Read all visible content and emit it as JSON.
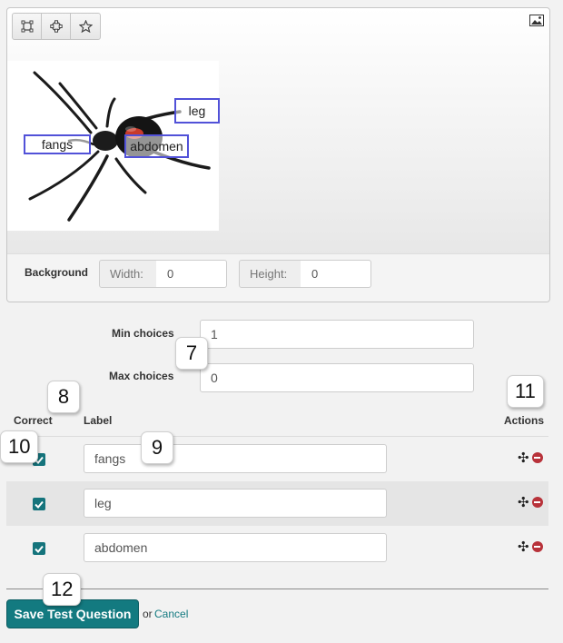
{
  "toolbar": {
    "tools": [
      "rectangle-tool-icon",
      "circle-tool-icon",
      "polygon-tool-icon"
    ],
    "image_icon": "image-icon"
  },
  "labels_on_image": {
    "leg": "leg",
    "fangs": "fangs",
    "abdomen": "abdomen"
  },
  "background": {
    "title": "Background",
    "width_label": "Width:",
    "width_value": "0",
    "height_label": "Height:",
    "height_value": "0"
  },
  "choices": {
    "min_label": "Min choices",
    "min_value": "1",
    "max_label": "Max choices",
    "max_value": "0"
  },
  "table": {
    "headers": {
      "correct": "Correct",
      "label": "Label",
      "actions": "Actions"
    },
    "rows": [
      {
        "label": "fangs",
        "correct": true
      },
      {
        "label": "leg",
        "correct": true
      },
      {
        "label": "abdomen",
        "correct": true
      }
    ]
  },
  "callouts": {
    "c7": "7",
    "c8": "8",
    "c9": "9",
    "c10": "10",
    "c11": "11",
    "c12": "12"
  },
  "footer": {
    "save_label": "Save Test Question",
    "or_text": "or",
    "cancel_label": "Cancel"
  },
  "colors": {
    "accent": "#137a80",
    "checkbox": "#15747c",
    "remove": "#b8323a",
    "label_border": "#5151d8"
  }
}
